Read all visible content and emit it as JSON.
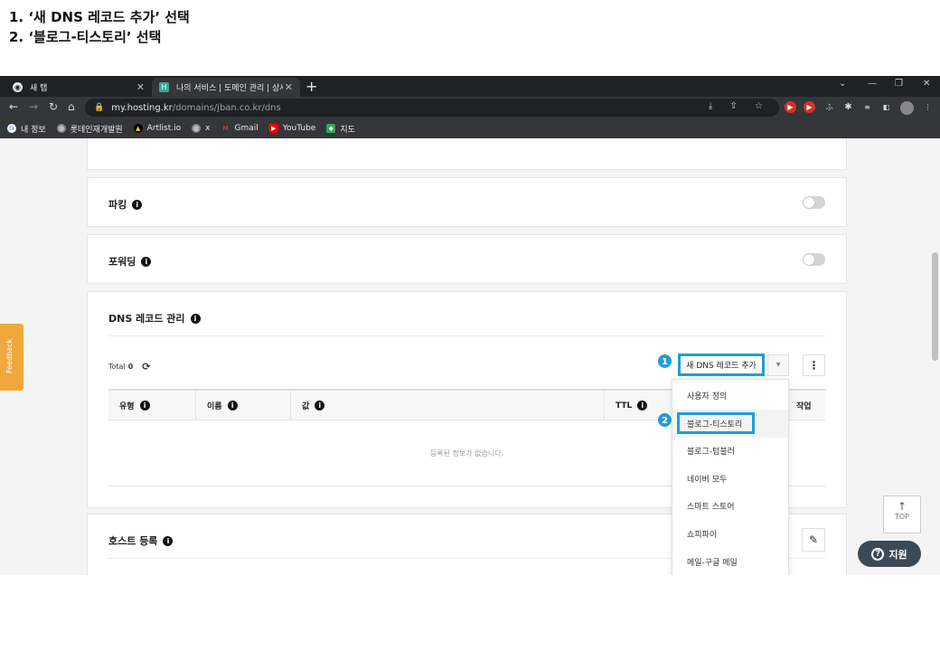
{
  "instructions": [
    "1. ‘새 DNS 레코드 추가’ 선택",
    "2. ‘블로그-티스토리’ 선택"
  ],
  "browser": {
    "tabs": [
      {
        "label": "새 탭",
        "active": false
      },
      {
        "label": "나의 서비스 | 도메인 관리 | 상세",
        "active": true
      }
    ],
    "new_tab": "+",
    "url_host": "my.hosting.kr",
    "url_path": "/domains/jban.co.kr/dns",
    "bookmarks": [
      "내 정보",
      "롯데인재개발원",
      "Artlist.io",
      "x",
      "Gmail",
      "YouTube",
      "지도"
    ]
  },
  "page": {
    "parking": {
      "title": "파킹",
      "enabled": false
    },
    "forwarding": {
      "title": "포워딩",
      "enabled": false
    },
    "dns": {
      "title": "DNS 레코드 관리",
      "total_label": "Total",
      "total_value": "0",
      "new_record_button": "새 DNS 레코드 추가",
      "columns": [
        "유형",
        "이름",
        "값",
        "TTL",
        "작업"
      ],
      "empty_text": "등록된 정보가 없습니다.",
      "dropdown_items": [
        "사용자 정의",
        "블로그-티스토리",
        "블로그-텀블러",
        "네이버 모두",
        "스마트 스토어",
        "쇼피파이",
        "메일-구글 메일"
      ]
    },
    "host": {
      "title": "호스트 등록"
    },
    "feedback_label": "Feedback",
    "top_label": "TOP",
    "support_label": "지원",
    "markers": [
      "1",
      "2"
    ]
  },
  "colors": {
    "highlight": "#1e9ed8",
    "feedback": "#f0a83c",
    "support": "#3b4a56"
  }
}
